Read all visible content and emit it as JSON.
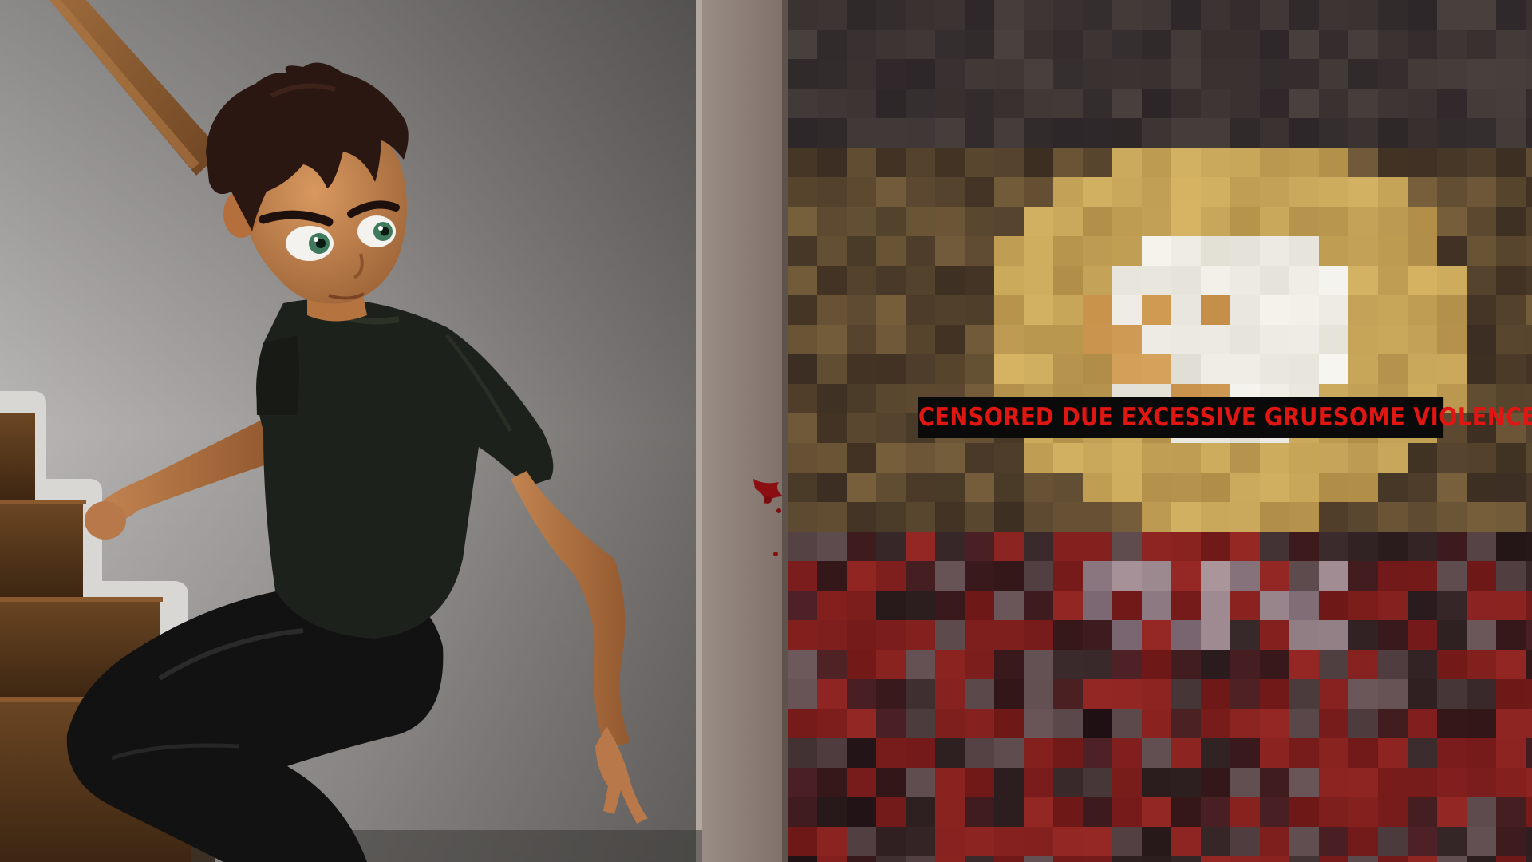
{
  "scene": {
    "censor_overlay": {
      "label": "CENSORED DUE EXCESSIVE GRUESOME VIOLENCE",
      "text_color": "#e01612",
      "background_color": "#0a0a0a"
    },
    "colors": {
      "wall": "#8f8c8a",
      "door_frame": "#8a7b72",
      "stair_wood": "#5a3a1e",
      "shirt": "#1c1f1a",
      "pants": "#141414",
      "hair": "#2a1712",
      "skin": "#b77a4a",
      "eyes": "#3f7a5c",
      "blood": "#8b0f12"
    }
  }
}
